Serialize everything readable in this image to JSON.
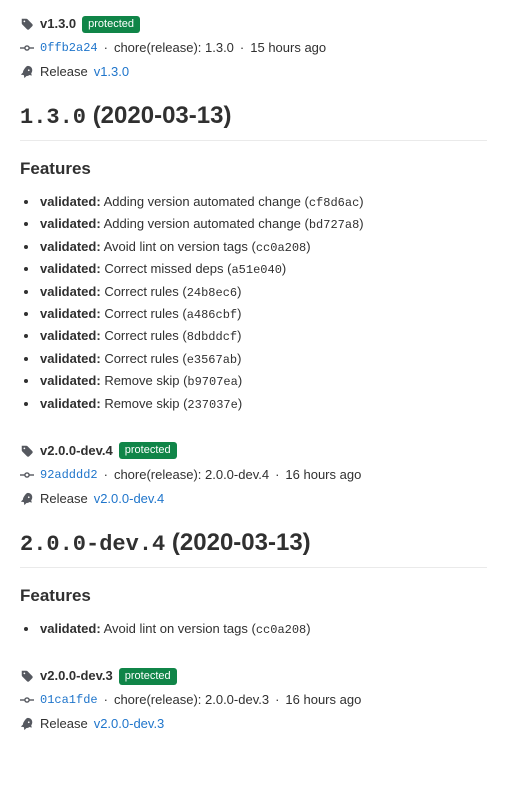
{
  "labels": {
    "protected": "protected",
    "release": "Release",
    "features": "Features"
  },
  "releases": [
    {
      "tag": "v1.3.0",
      "protected": true,
      "commit_sha": "0ffb2a24",
      "commit_msg": "chore(release): 1.3.0",
      "time": "15 hours ago",
      "release_link_text": "v1.3.0",
      "heading_version": "1.3.0",
      "heading_date": "(2020-03-13)",
      "features": [
        {
          "label": "validated:",
          "desc": "Adding version automated change",
          "hash": "cf8d6ac"
        },
        {
          "label": "validated:",
          "desc": "Adding version automated change",
          "hash": "bd727a8"
        },
        {
          "label": "validated:",
          "desc": "Avoid lint on version tags",
          "hash": "cc0a208"
        },
        {
          "label": "validated:",
          "desc": "Correct missed deps",
          "hash": "a51e040"
        },
        {
          "label": "validated:",
          "desc": "Correct rules",
          "hash": "24b8ec6"
        },
        {
          "label": "validated:",
          "desc": "Correct rules",
          "hash": "a486cbf"
        },
        {
          "label": "validated:",
          "desc": "Correct rules",
          "hash": "8dbddcf"
        },
        {
          "label": "validated:",
          "desc": "Correct rules",
          "hash": "e3567ab"
        },
        {
          "label": "validated:",
          "desc": "Remove skip",
          "hash": "b9707ea"
        },
        {
          "label": "validated:",
          "desc": "Remove skip",
          "hash": "237037e"
        }
      ]
    },
    {
      "tag": "v2.0.0-dev.4",
      "protected": true,
      "commit_sha": "92adddd2",
      "commit_msg": "chore(release): 2.0.0-dev.4",
      "time": "16 hours ago",
      "release_link_text": "v2.0.0-dev.4",
      "heading_version": "2.0.0-dev.4",
      "heading_date": "(2020-03-13)",
      "features": [
        {
          "label": "validated:",
          "desc": "Avoid lint on version tags",
          "hash": "cc0a208"
        }
      ]
    },
    {
      "tag": "v2.0.0-dev.3",
      "protected": true,
      "commit_sha": "01ca1fde",
      "commit_msg": "chore(release): 2.0.0-dev.3",
      "time": "16 hours ago",
      "release_link_text": "v2.0.0-dev.3",
      "heading_version": null,
      "heading_date": null,
      "features": null
    }
  ]
}
